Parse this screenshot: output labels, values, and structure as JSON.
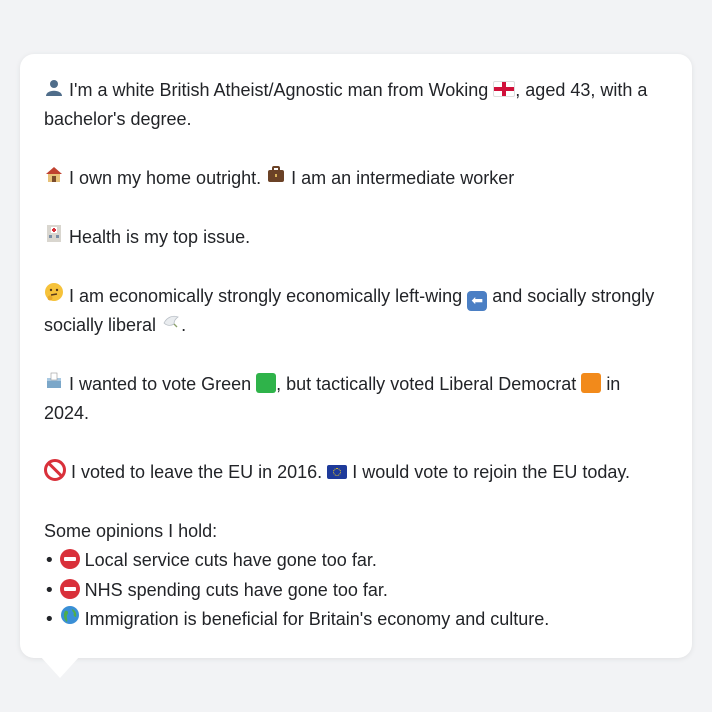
{
  "colors": {
    "background": "#f2f3f5",
    "card": "#ffffff",
    "text": "#222428",
    "green_square": "#2fb34a",
    "orange_square": "#f28a1b",
    "stop_red": "#d9303a"
  },
  "profile": {
    "identity": {
      "icon": "person-silhouette-icon",
      "text_before_flag": "I'm a white British Atheist/Agnostic man from Woking",
      "flag": "england-flag-icon",
      "text_after_flag": ", aged 43, with a bachelor's degree."
    },
    "home": {
      "icon": "house-icon",
      "text": "I own my home outright.",
      "work_icon": "briefcase-icon",
      "work_text": "I am an intermediate worker"
    },
    "issue": {
      "icon": "hospital-icon",
      "text": "Health is my top issue."
    },
    "ideology": {
      "icon": "thinking-face-icon",
      "text_1": "I am economically strongly economically left-wing",
      "left_icon": "left-arrow-icon",
      "text_2": "and socially strongly socially liberal",
      "dove_icon": "dove-icon",
      "text_3": "."
    },
    "vote": {
      "icon": "ballot-box-icon",
      "text_1": "I wanted to vote Green",
      "green_icon": "green-square-icon",
      "text_2": ", but tactically voted Liberal Democrat",
      "orange_icon": "orange-square-icon",
      "text_3": "in 2024."
    },
    "brexit": {
      "icon": "prohibited-icon",
      "text_1": "I voted to leave the EU in 2016.",
      "eu_icon": "eu-flag-icon",
      "text_2": "I would vote to rejoin the EU today."
    },
    "opinions": {
      "heading": "Some opinions I hold:",
      "items": [
        {
          "icon": "stop-sign-icon",
          "text": "Local service cuts have gone too far."
        },
        {
          "icon": "stop-sign-icon",
          "text": "NHS spending cuts have gone too far."
        },
        {
          "icon": "globe-icon",
          "text": "Immigration is beneficial for Britain's economy and culture."
        }
      ]
    }
  }
}
